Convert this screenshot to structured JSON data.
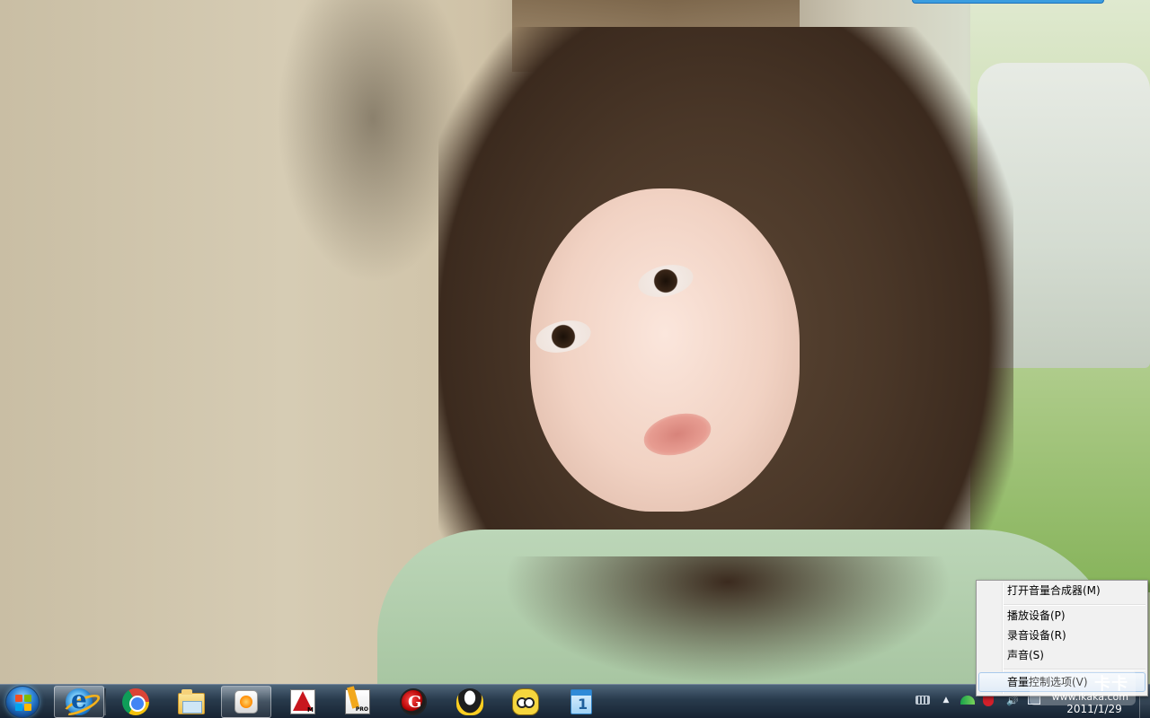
{
  "desktop": {
    "wallpaper": "photo-portrait-wallpaper"
  },
  "taskbar": {
    "start_icon": "windows-start-orb-icon",
    "pinned": [
      {
        "id": "ie",
        "icon": "internet-explorer-icon",
        "active": true
      },
      {
        "id": "chrome",
        "icon": "chrome-icon",
        "active": false
      },
      {
        "id": "explorer",
        "icon": "folder-icon",
        "active": false
      },
      {
        "id": "media-player",
        "icon": "media-player-icon",
        "active": true
      },
      {
        "id": "autocad",
        "icon": "autocad-icon",
        "active": false
      },
      {
        "id": "pro-app",
        "icon": "pro-pencil-icon",
        "active": false
      },
      {
        "id": "ghost",
        "icon": "ghost-icon",
        "active": false
      },
      {
        "id": "qq",
        "icon": "qq-penguin-icon",
        "active": false
      },
      {
        "id": "cat-app",
        "icon": "cartoon-cat-icon",
        "active": false
      },
      {
        "id": "calendar",
        "icon": "calendar-icon",
        "active": false
      }
    ],
    "tray": {
      "show_hidden_glyph": "▲",
      "volume_glyph": "🔊",
      "date": "2011/1/29"
    }
  },
  "context_menu": {
    "items": [
      {
        "label": "打开音量合成器(M)"
      },
      {
        "label": "播放设备(P)"
      },
      {
        "label": "录音设备(R)"
      },
      {
        "label": "声音(S)"
      },
      {
        "label": "音量控制选项(V)"
      }
    ]
  },
  "watermark": {
    "brand": "卡卡",
    "url": "www.ikaka.com"
  },
  "colors": {
    "taskbar": "#1f3448",
    "menu_bg": "#f1f1f1",
    "menu_border": "#979797"
  }
}
